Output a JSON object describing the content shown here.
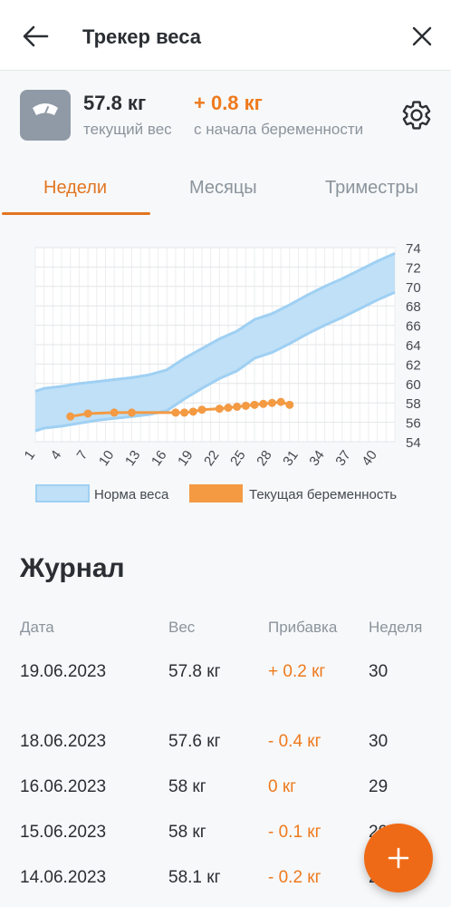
{
  "header": {
    "title": "Трекер веса"
  },
  "summary": {
    "current_weight": "57.8 кг",
    "current_weight_label": "текущий вес",
    "gain": "+ 0.8 кг",
    "gain_label": "с начала беременности"
  },
  "tabs": [
    {
      "label": "Недели",
      "active": true
    },
    {
      "label": "Месяцы",
      "active": false
    },
    {
      "label": "Триместры",
      "active": false
    }
  ],
  "chart_data": {
    "type": "area",
    "x_ticks": [
      "1",
      "4",
      "7",
      "10",
      "13",
      "16",
      "19",
      "22",
      "25",
      "28",
      "31",
      "34",
      "37",
      "40"
    ],
    "y_ticks": [
      "54",
      "56",
      "58",
      "60",
      "62",
      "64",
      "66",
      "68",
      "70",
      "72",
      "74"
    ],
    "xlim": [
      1,
      42
    ],
    "ylim": [
      54,
      74
    ],
    "grid": true,
    "legend_position": "bottom",
    "legend": [
      "Норма веса",
      "Текущая беременность"
    ],
    "norm_range": {
      "name": "Норма веса",
      "x": [
        1,
        2,
        4,
        6,
        8,
        10,
        12,
        14,
        16,
        18,
        20,
        22,
        24,
        26,
        28,
        30,
        32,
        34,
        36,
        38,
        40,
        42
      ],
      "upper": [
        59.2,
        59.5,
        59.7,
        60.0,
        60.2,
        60.4,
        60.6,
        60.9,
        61.4,
        62.6,
        63.6,
        64.6,
        65.4,
        66.6,
        67.2,
        68.1,
        69.1,
        70.0,
        70.8,
        71.7,
        72.6,
        73.4
      ],
      "lower": [
        55.1,
        55.4,
        55.6,
        55.9,
        56.2,
        56.4,
        56.6,
        56.8,
        57.2,
        58.4,
        59.5,
        60.5,
        61.3,
        62.6,
        63.2,
        64.1,
        65.1,
        66.0,
        66.8,
        67.7,
        68.6,
        69.4
      ]
    },
    "series": [
      {
        "name": "Текущая беременность",
        "x": [
          5,
          7,
          10,
          12,
          17,
          18,
          19,
          20,
          22,
          23,
          24,
          25,
          26,
          27,
          28,
          29,
          30
        ],
        "y": [
          56.6,
          56.9,
          57.0,
          57.0,
          57.0,
          57.0,
          57.1,
          57.3,
          57.4,
          57.5,
          57.6,
          57.7,
          57.8,
          57.9,
          58.0,
          58.1,
          57.8
        ]
      }
    ],
    "colors": {
      "norm_fill": "#bfe0f7",
      "norm_stroke": "#9fd0f3",
      "series": "#f39a43"
    }
  },
  "journal": {
    "title": "Журнал",
    "headers": [
      "Дата",
      "Вес",
      "Прибавка",
      "Неделя"
    ],
    "rows": [
      {
        "date": "19.06.2023",
        "weight": "57.8 кг",
        "gain": "+ 0.2 кг",
        "week": "30"
      },
      {
        "date": "18.06.2023",
        "weight": "57.6 кг",
        "gain": "- 0.4 кг",
        "week": "30"
      },
      {
        "date": "16.06.2023",
        "weight": "58 кг",
        "gain": "0 кг",
        "week": "29"
      },
      {
        "date": "15.06.2023",
        "weight": "58 кг",
        "gain": "- 0.1 кг",
        "week": "29"
      },
      {
        "date": "14.06.2023",
        "weight": "58.1 кг",
        "gain": "- 0.2 кг",
        "week": "29"
      }
    ]
  },
  "icons": {
    "back": "arrow-left-icon",
    "close": "close-icon",
    "scale": "scale-icon",
    "settings": "gear-icon",
    "add": "plus-icon"
  },
  "colors": {
    "accent": "#ee7a1d",
    "fab": "#ef6a16",
    "muted": "#8b949c"
  }
}
